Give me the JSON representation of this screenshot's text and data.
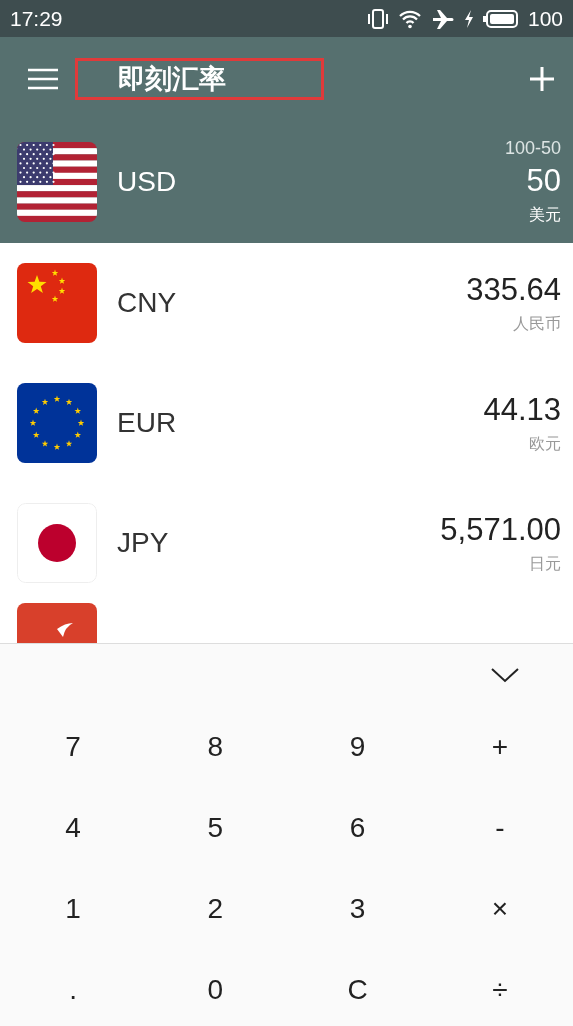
{
  "status_bar": {
    "time": "17:29",
    "battery": "100"
  },
  "toolbar": {
    "title": "即刻汇率"
  },
  "base": {
    "flag": {
      "kind": "us"
    },
    "code": "USD",
    "expression": "100-50",
    "amount": "50",
    "name": "美元"
  },
  "currencies": [
    {
      "flag": {
        "kind": "cn"
      },
      "code": "CNY",
      "amount": "335.64",
      "name": "人民币"
    },
    {
      "flag": {
        "kind": "eu"
      },
      "code": "EUR",
      "amount": "44.13",
      "name": "欧元"
    },
    {
      "flag": {
        "kind": "jp"
      },
      "code": "JPY",
      "amount": "5,571.00",
      "name": "日元"
    }
  ],
  "partial_row": {
    "flag": {
      "kind": "hk"
    }
  },
  "keypad": {
    "keys": [
      [
        "7",
        "8",
        "9",
        "+"
      ],
      [
        "4",
        "5",
        "6",
        "-"
      ],
      [
        "1",
        "2",
        "3",
        "×"
      ],
      [
        ".",
        "0",
        "C",
        "÷"
      ]
    ]
  }
}
